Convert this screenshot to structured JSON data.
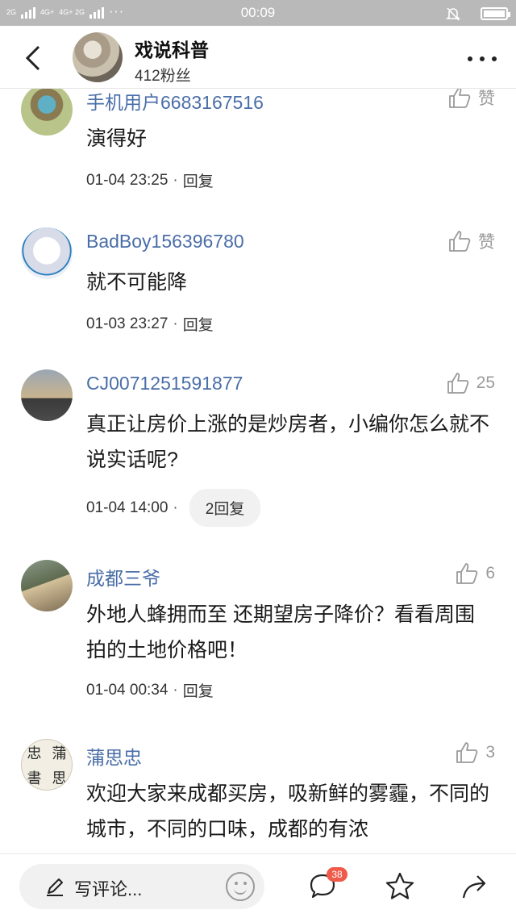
{
  "status_bar": {
    "network_1": "2G",
    "network_2": "4G+",
    "network_3": "4G+ 2G",
    "dots": "···",
    "time": "00:09"
  },
  "header": {
    "title": "戏说科普",
    "followers": "412粉丝"
  },
  "comments": [
    {
      "name": "手机用户6683167516",
      "like_label": "赞",
      "text": "演得好",
      "time": "01-04 23:25",
      "sep": "·",
      "reply": "回复"
    },
    {
      "name": "BadBoy156396780",
      "like_label": "赞",
      "text": "就不可能降",
      "time": "01-03 23:27",
      "sep": "·",
      "reply": "回复"
    },
    {
      "name": "CJ0071251591877",
      "like_label": "25",
      "text": "真正让房价上涨的是炒房者，小编你怎么就不说实话呢?",
      "time": "01-04 14:00",
      "sep": "·",
      "reply": "2回复"
    },
    {
      "name": "成都三爷",
      "like_label": "6",
      "text": "外地人蜂拥而至 还期望房子降价？看看周围拍的土地价格吧！",
      "time": "01-04 00:34",
      "sep": "·",
      "reply": "回复"
    },
    {
      "name": "蒲思忠",
      "like_label": "3",
      "text": "欢迎大家来成都买房，吸新鲜的雾霾，不同的城市，不同的口味，成都的有浓",
      "avatar_chars": [
        "忠",
        "蒲",
        "書",
        "思"
      ]
    }
  ],
  "bottom_bar": {
    "write_placeholder": "写评论...",
    "comment_count": "38"
  }
}
